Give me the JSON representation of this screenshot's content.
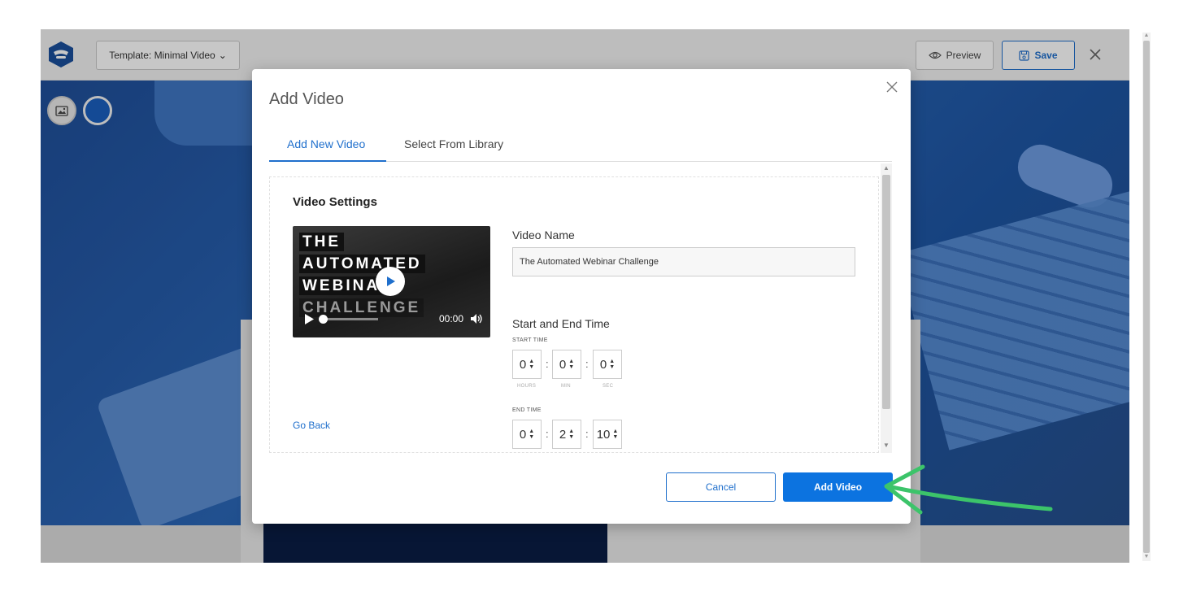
{
  "topbar": {
    "template_label": "Template: Minimal Video",
    "template_caret": "⌄",
    "preview_label": "Preview",
    "save_label": "Save"
  },
  "modal": {
    "title": "Add Video",
    "tabs": [
      {
        "label": "Add New Video",
        "active": true
      },
      {
        "label": "Select From Library",
        "active": false
      }
    ],
    "section_title": "Video Settings",
    "video_thumbnail": {
      "lines": [
        "THE",
        "AUTOMATED",
        "WEBINAR",
        "CHALLENGE"
      ],
      "time": "00:00"
    },
    "go_back": "Go Back",
    "video_name_label": "Video Name",
    "video_name_value": "The Automated Webinar Challenge",
    "start_end_label": "Start and End Time",
    "start_time_label": "START TIME",
    "end_time_label": "END TIME",
    "units": {
      "hours": "HOURS",
      "min": "MIN",
      "sec": "SEC"
    },
    "start_time": {
      "hours": "0",
      "min": "0",
      "sec": "0"
    },
    "end_time": {
      "hours": "0",
      "min": "2",
      "sec": "10"
    },
    "separator": ":",
    "cancel_label": "Cancel",
    "add_label": "Add Video"
  },
  "colors": {
    "accent": "#1f6fcc",
    "primary_button": "#0c73e0",
    "annotation_arrow": "#3cc46a",
    "hero_tint": "#1f4f9a"
  }
}
